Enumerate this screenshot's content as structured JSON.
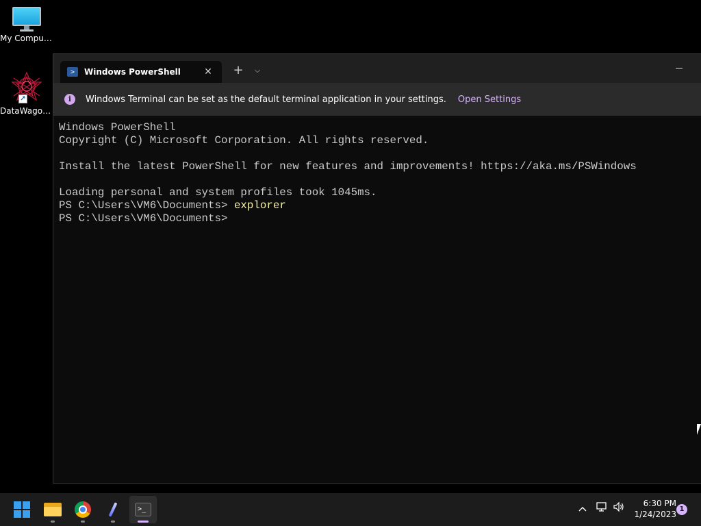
{
  "desktop": {
    "icons": [
      {
        "label": "My Computer",
        "icon": "monitor-icon"
      },
      {
        "label": "DataWagon...",
        "icon": "datawagon-app-icon"
      }
    ]
  },
  "window": {
    "tab_title": "Windows PowerShell",
    "tab_icon": "powershell-icon",
    "new_tab_symbol": "+",
    "dropdown_symbol": "⌵",
    "close_symbol": "✕"
  },
  "infobar": {
    "icon": "i",
    "message": "Windows Terminal can be set as the default terminal application in your settings.",
    "link": "Open Settings"
  },
  "console": {
    "lines": [
      "Windows PowerShell",
      "Copyright (C) Microsoft Corporation. All rights reserved.",
      "",
      "Install the latest PowerShell for new features and improvements! https://aka.ms/PSWindows",
      "",
      "Loading personal and system profiles took 1045ms."
    ],
    "prompt": "PS C:\\Users\\VM6\\Documents> ",
    "command": "explorer",
    "current_prompt": "PS C:\\Users\\VM6\\Documents> "
  },
  "taskbar": {
    "apps": [
      "start-button",
      "file-explorer",
      "chrome",
      "pen-app",
      "windows-terminal"
    ],
    "tray_chevron": "^",
    "clock_time": "6:30 PM",
    "clock_date": "1/24/2023",
    "notification_count": "1"
  },
  "colors": {
    "terminal_bg": "#0c0c0c",
    "console_text": "#cccccc",
    "command_text": "#f9f1a5",
    "accent": "#d8b4fe",
    "taskbar_bg": "#1c1c1c"
  }
}
